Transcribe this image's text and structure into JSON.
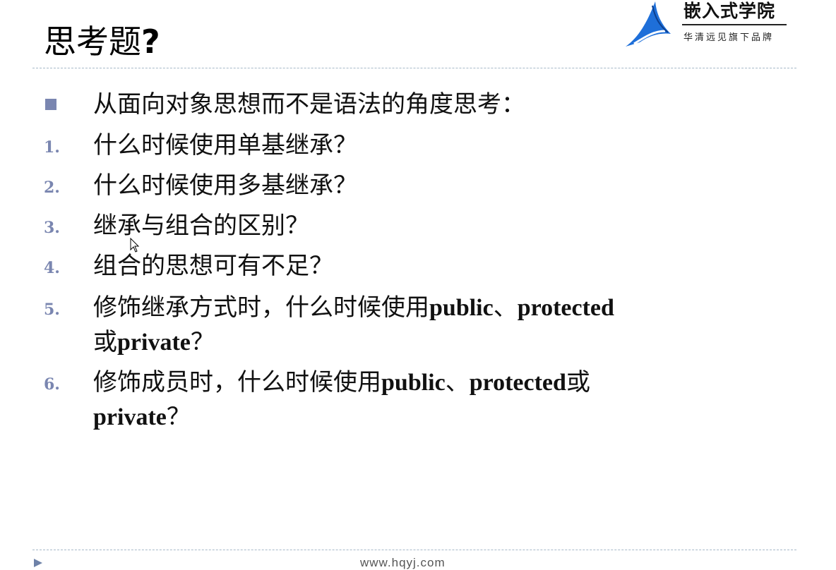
{
  "title": {
    "text": "思考题",
    "mark": "?"
  },
  "logo": {
    "name": "嵌入式学院",
    "sub": "华清远见旗下品牌",
    "icon": "sail-logo-icon",
    "color": "#1e6fd9"
  },
  "bullet": {
    "icon": "square-bullet-icon",
    "text": "从面向对象思想而不是语法的角度思考："
  },
  "items": [
    {
      "num": "1.",
      "text": "什么时候使用单基继承？"
    },
    {
      "num": "2.",
      "text": "什么时候使用多基继承？"
    },
    {
      "num": "3.",
      "text": "继承与组合的区别？"
    },
    {
      "num": "4.",
      "text": "组合的思想可有不足？"
    },
    {
      "num": "5.",
      "line1": "修饰继承方式时，什么时候使用",
      "kw1": "public",
      "sep1": "、",
      "kw2": "protected",
      "line2_pre": "或",
      "kw3": "private",
      "q": "？"
    },
    {
      "num": "6.",
      "line1": "修饰成员时，什么时候使用",
      "kw1": "public",
      "sep1": "、",
      "kw2": "protected",
      "tail1": "或",
      "kw3": "private",
      "q": "？"
    }
  ],
  "footer": {
    "text": "www.hqyj.com",
    "icon": "triangle-arrow-icon"
  },
  "colors": {
    "accent": "#7a86b0",
    "rule": "#a6b8c8"
  }
}
